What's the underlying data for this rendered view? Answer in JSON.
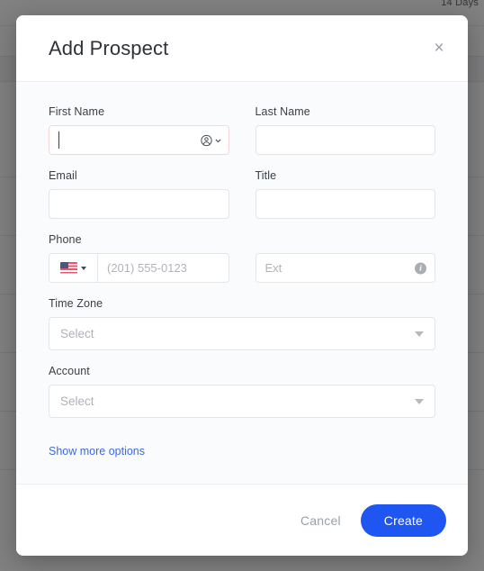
{
  "background": {
    "topbar_text": "14 Days"
  },
  "modal": {
    "title": "Add Prospect",
    "close_label": "×",
    "fields": {
      "first_name": {
        "label": "First Name",
        "value": "",
        "placeholder": "",
        "focused": true,
        "autofill_icon": "person-circle-icon"
      },
      "last_name": {
        "label": "Last Name",
        "value": "",
        "placeholder": ""
      },
      "email": {
        "label": "Email",
        "value": "",
        "placeholder": ""
      },
      "title": {
        "label": "Title",
        "value": "",
        "placeholder": ""
      },
      "phone": {
        "label": "Phone",
        "country": "US",
        "value": "",
        "placeholder": "(201) 555-0123"
      },
      "ext": {
        "value": "",
        "placeholder": "Ext",
        "info_icon": "info-icon"
      },
      "time_zone": {
        "label": "Time Zone",
        "value": "Select"
      },
      "account": {
        "label": "Account",
        "value": "Select"
      }
    },
    "show_more_label": "Show more options",
    "footer": {
      "cancel_label": "Cancel",
      "create_label": "Create"
    }
  },
  "colors": {
    "primary": "#1f55f0",
    "link": "#3b6ae1",
    "body_bg": "#fafbfc",
    "border": "#e3e5e9",
    "muted_text": "#9aa0a6"
  }
}
